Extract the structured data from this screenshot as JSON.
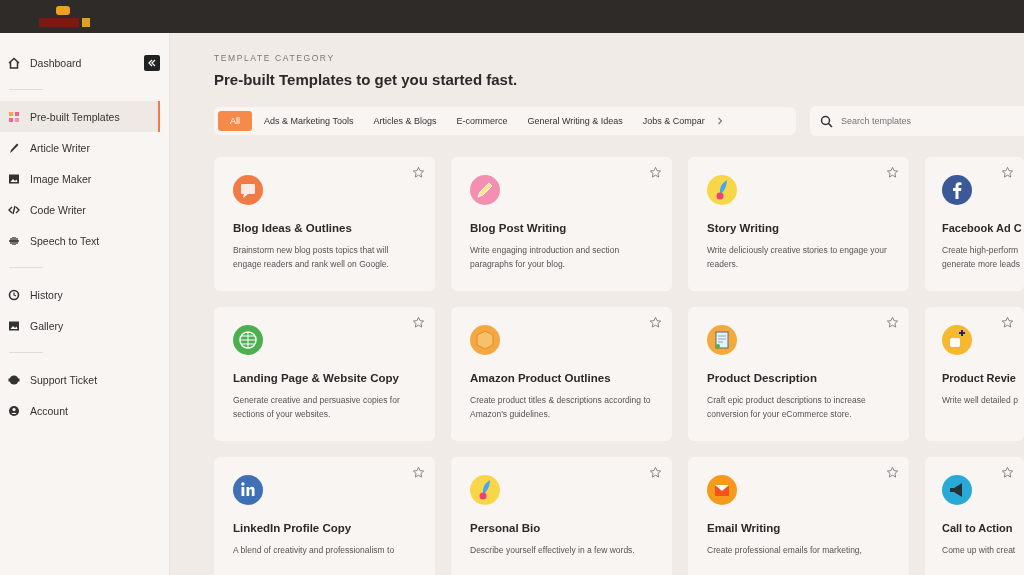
{
  "sidebar": {
    "sections": [
      {
        "items": [
          {
            "label": "Dashboard",
            "selected": false
          }
        ]
      },
      {
        "items": [
          {
            "label": "Pre-built Templates",
            "selected": true
          },
          {
            "label": "Article Writer",
            "selected": false
          },
          {
            "label": "Image Maker",
            "selected": false
          },
          {
            "label": "Code Writer",
            "selected": false
          },
          {
            "label": "Speech to Text",
            "selected": false
          }
        ]
      },
      {
        "items": [
          {
            "label": "History",
            "selected": false
          },
          {
            "label": "Gallery",
            "selected": false
          }
        ]
      },
      {
        "items": [
          {
            "label": "Support Ticket",
            "selected": false
          },
          {
            "label": "Account",
            "selected": false
          }
        ]
      }
    ]
  },
  "header": {
    "eyebrow": "TEMPLATE CATEGORY",
    "title": "Pre-built Templates to get you started fast."
  },
  "category_tabs": [
    {
      "label": "All",
      "selected": true
    },
    {
      "label": "Ads & Marketing Tools",
      "selected": false
    },
    {
      "label": "Articles & Blogs",
      "selected": false
    },
    {
      "label": "E-commerce",
      "selected": false
    },
    {
      "label": "General Writing & Ideas",
      "selected": false
    },
    {
      "label": "Jobs & Compar",
      "selected": false
    }
  ],
  "search": {
    "placeholder": "Search templates"
  },
  "templates": [
    {
      "title": "Blog Ideas & Outlines",
      "description": "Brainstorm new blog posts topics that will engage readers and rank well on Google.",
      "color": "#f27a45"
    },
    {
      "title": "Blog Post Writing",
      "description": "Write engaging introduction and section paragraphs for your blog.",
      "color": "#f48fb1"
    },
    {
      "title": "Story Writing",
      "description": "Write deliciously creative stories to engage your readers.",
      "color": "#f9d648"
    },
    {
      "title": "Facebook Ad C",
      "description": "Create high-perform generate more leads",
      "color": "#3b5998"
    },
    {
      "title": "Landing Page & Website Copy",
      "description": "Generate creative and persuasive copies for sections of your websites.",
      "color": "#4caf50"
    },
    {
      "title": "Amazon Product Outlines",
      "description": "Create product titles & descriptions according to Amazon's guidelines.",
      "color": "#f5a742"
    },
    {
      "title": "Product Description",
      "description": "Craft epic product descriptions to increase conversion for your eCommerce store.",
      "color": "#f3a93b"
    },
    {
      "title": "Product Revie",
      "description": "Write well detailed p",
      "color": "#f5b82e"
    },
    {
      "title": "LinkedIn Profile Copy",
      "description": "A blend of creativity and professionalism to",
      "color": "#3f6fb5"
    },
    {
      "title": "Personal Bio",
      "description": "Describe yourself effectively in a few words.",
      "color": "#f9d648"
    },
    {
      "title": "Email Writing",
      "description": "Create professional emails for marketing,",
      "color": "#f59a1b"
    },
    {
      "title": "Call to Action",
      "description": "Come up with creat",
      "color": "#29a9d6"
    }
  ]
}
